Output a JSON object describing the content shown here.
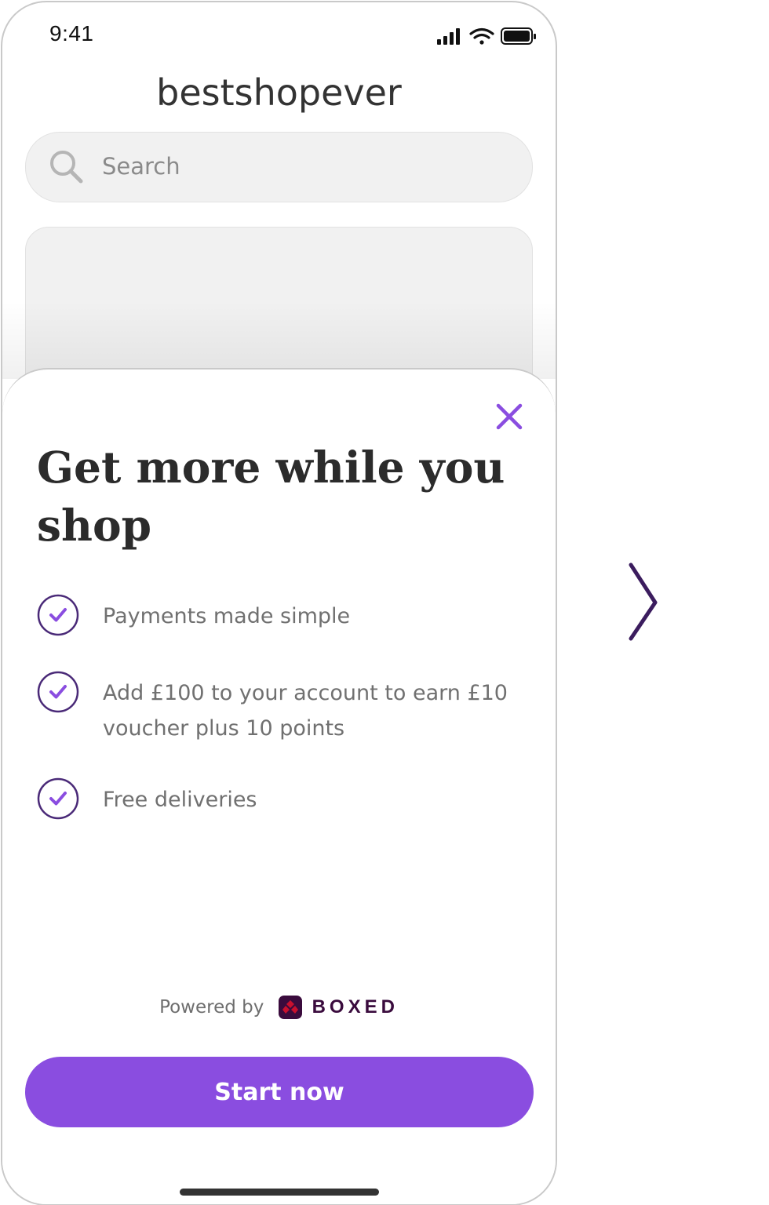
{
  "status_bar": {
    "time": "9:41"
  },
  "header": {
    "brand": "bestshopever"
  },
  "search": {
    "placeholder": "Search",
    "icon": "search-icon"
  },
  "sheet": {
    "close_icon": "close-icon",
    "headline": "Get more while you shop",
    "benefits": [
      {
        "icon": "check-circle-icon",
        "text": "Payments made simple"
      },
      {
        "icon": "check-circle-icon",
        "text": "Add £100 to your account to earn £10 voucher plus 10 points"
      },
      {
        "icon": "check-circle-icon",
        "text": "Free deliveries"
      }
    ],
    "powered_by_label": "Powered by",
    "provider_name": "BOXED",
    "cta_label": "Start now"
  },
  "navigation": {
    "next_icon": "chevron-right-icon"
  },
  "colors": {
    "accent": "#8a4de0",
    "check_ring": "#4a2a78",
    "provider_brand": "#3a0b3d",
    "provider_mark": "#c8102e",
    "headline": "#2b2b2b",
    "body_text": "#707070"
  }
}
